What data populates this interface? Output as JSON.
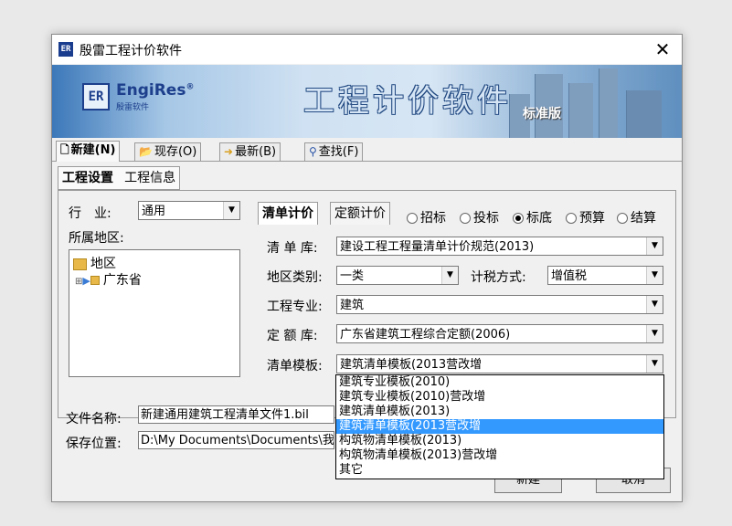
{
  "window": {
    "title": "殷雷工程计价软件",
    "app_icon": "ER"
  },
  "banner": {
    "logo_mark": "ER",
    "logo_name": "EngiRes",
    "logo_registered": "®",
    "logo_sub": "殷雷软件",
    "title": "工程计价软件",
    "edition": "标准版"
  },
  "main_tabs": [
    {
      "label": "新建(N)",
      "icon": "new-file-icon",
      "active": true
    },
    {
      "label": "现存(O)",
      "icon": "open-folder-icon",
      "active": false
    },
    {
      "label": "最新(B)",
      "icon": "recent-icon",
      "active": false
    },
    {
      "label": "查找(F)",
      "icon": "binoculars-icon",
      "active": false
    }
  ],
  "sub_tabs": [
    {
      "label": "工程设置",
      "active": true
    },
    {
      "label": "工程信息",
      "active": false
    }
  ],
  "industry": {
    "label": "行　业:",
    "value": "通用"
  },
  "region": {
    "label": "所属地区:",
    "tree_root": "地区",
    "tree_child": "广东省"
  },
  "bill_tabs": [
    {
      "label": "清单计价",
      "active": true
    },
    {
      "label": "定额计价",
      "active": false
    }
  ],
  "stages": [
    {
      "label": "招标",
      "checked": false
    },
    {
      "label": "投标",
      "checked": false
    },
    {
      "label": "标底",
      "checked": true
    },
    {
      "label": "预算",
      "checked": false
    },
    {
      "label": "结算",
      "checked": false
    }
  ],
  "form": {
    "bill_library": {
      "label": "清 单 库:",
      "value": "建设工程工程量清单计价规范(2013)"
    },
    "region_type": {
      "label": "地区类别:",
      "value": "一类"
    },
    "tax_method": {
      "label": "计税方式:",
      "value": "增值税"
    },
    "specialty": {
      "label": "工程专业:",
      "value": "建筑"
    },
    "quota_library": {
      "label": "定 额 库:",
      "value": "广东省建筑工程综合定额(2006)"
    },
    "bill_template": {
      "label": "清单模板:",
      "value": "建筑清单模板(2013营改增"
    }
  },
  "template_options": [
    {
      "label": "建筑专业模板(2010)",
      "selected": false
    },
    {
      "label": "建筑专业模板(2010)营改增",
      "selected": false
    },
    {
      "label": "建筑清单模板(2013)",
      "selected": false
    },
    {
      "label": "建筑清单模板(2013营改增",
      "selected": true
    },
    {
      "label": "构筑物清单模板(2013)",
      "selected": false
    },
    {
      "label": "构筑物清单模板(2013)营改增",
      "selected": false
    },
    {
      "label": "其它",
      "selected": false
    }
  ],
  "file": {
    "name_label": "文件名称:",
    "name_value": "新建通用建筑工程清单文件1.bil",
    "path_label": "保存位置:",
    "path_value": "D:\\My Documents\\Documents\\我的"
  },
  "buttons": {
    "ok": "新建",
    "cancel": "取消"
  }
}
